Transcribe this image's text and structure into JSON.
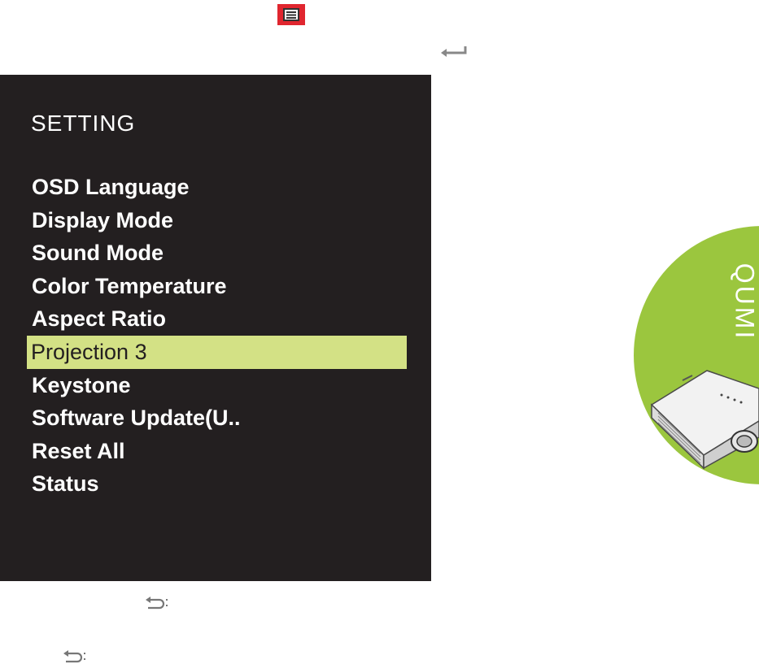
{
  "osd": {
    "title": "SETTING",
    "items": [
      {
        "label": "OSD Language",
        "selected": false
      },
      {
        "label": "Display Mode",
        "selected": false
      },
      {
        "label": "Sound Mode",
        "selected": false
      },
      {
        "label": "Color Temperature",
        "selected": false
      },
      {
        "label": "Aspect Ratio",
        "selected": false
      },
      {
        "label": "Projection 3",
        "selected": true
      },
      {
        "label": "Keystone",
        "selected": false
      },
      {
        "label": "Software Update(U..",
        "selected": false
      },
      {
        "label": "Reset All",
        "selected": false
      },
      {
        "label": "Status",
        "selected": false
      }
    ],
    "highlight_color": "#d3e185",
    "background_color": "#231f20"
  },
  "icons": {
    "menu_key": "menu-key-icon",
    "enter": "enter-icon",
    "return": "return-icon"
  },
  "badge": {
    "brand": "QUMI",
    "color": "#9bc63e"
  }
}
